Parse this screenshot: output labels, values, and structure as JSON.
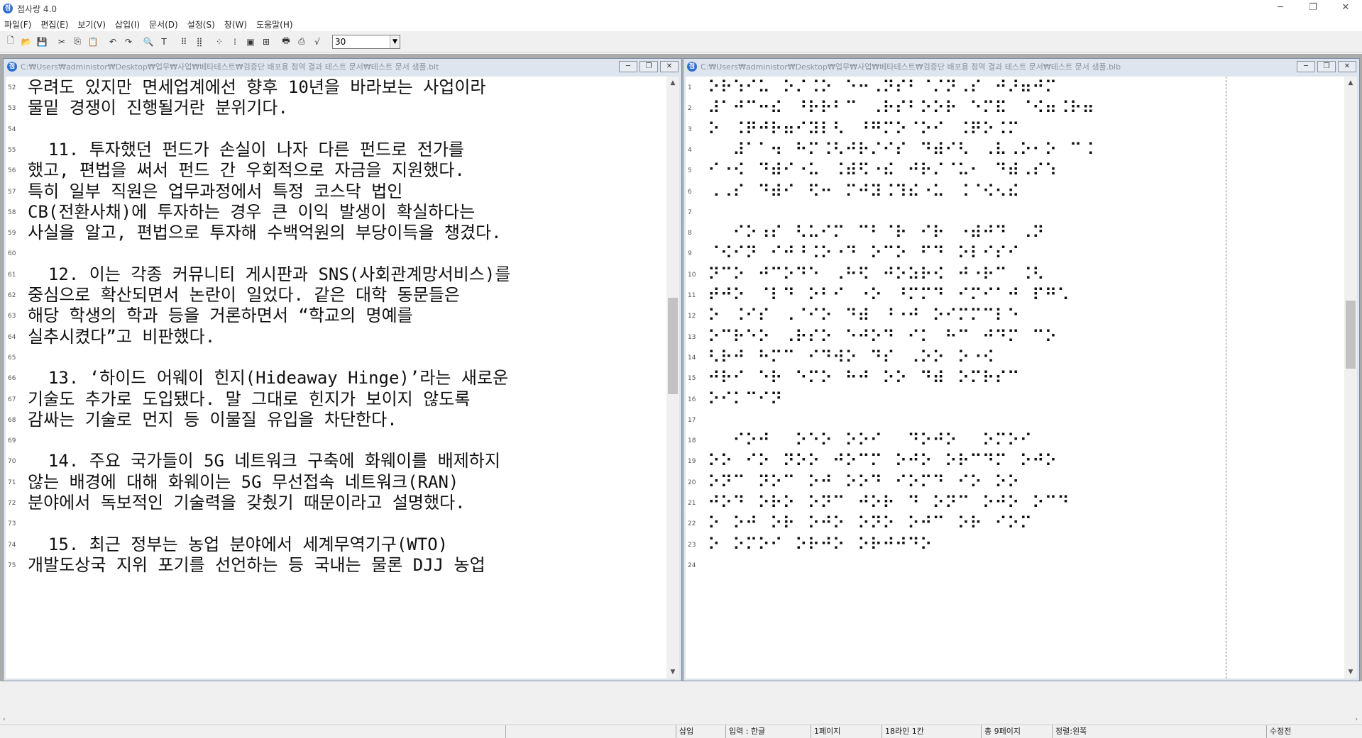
{
  "window": {
    "title": "점사랑 4.0",
    "app_icon": "점",
    "controls": {
      "minimize": "─",
      "restore": "❐",
      "close": "✕"
    }
  },
  "menu": [
    "파일(F)",
    "편집(E)",
    "보기(V)",
    "삽입(I)",
    "문서(D)",
    "설정(S)",
    "창(W)",
    "도움말(H)"
  ],
  "toolbar": {
    "buttons": [
      {
        "icon": "new-file-icon",
        "glyph": "🗋"
      },
      {
        "icon": "open-folder-icon",
        "glyph": "📂"
      },
      {
        "icon": "save-icon",
        "glyph": "💾"
      },
      {
        "icon": "cut-icon",
        "glyph": "✂"
      },
      {
        "icon": "copy-icon",
        "glyph": "⎘"
      },
      {
        "icon": "paste-icon",
        "glyph": "📋"
      },
      {
        "icon": "undo-icon",
        "glyph": "↶"
      },
      {
        "icon": "redo-icon",
        "glyph": "↷"
      },
      {
        "icon": "search-icon",
        "glyph": "🔍"
      },
      {
        "icon": "text-mode-icon",
        "glyph": "T"
      },
      {
        "icon": "braille-cell-icon",
        "glyph": "⠿"
      },
      {
        "icon": "braille-view-icon",
        "glyph": "⣿"
      },
      {
        "icon": "grid-icon",
        "glyph": "⁘"
      },
      {
        "icon": "dots-icon",
        "glyph": "⁞"
      },
      {
        "icon": "box-icon",
        "glyph": "▣"
      },
      {
        "icon": "table-icon",
        "glyph": "⊞"
      },
      {
        "icon": "print-icon",
        "glyph": "🖶"
      },
      {
        "icon": "print-preview-icon",
        "glyph": "⎙"
      },
      {
        "icon": "formula-icon",
        "glyph": "√"
      }
    ],
    "zoom_value": "30",
    "zoom_arrow": "▼"
  },
  "left_doc": {
    "path": "C:₩Users₩administor₩Desktop₩업무₩사업₩베타테스트₩검증단 배포용 점역 결과 테스트 문서₩테스트 문서 샘플.blt",
    "icon": "점",
    "line_numbers": [
      "52",
      "53",
      "54",
      "55",
      "56",
      "57",
      "58",
      "59",
      "60",
      "61",
      "62",
      "63",
      "64",
      "65",
      "66",
      "67",
      "68",
      "69",
      "70",
      "71",
      "72",
      "73",
      "74",
      "75"
    ],
    "lines": [
      "우려도 있지만 면세업계에선 향후 10년을 바라보는 사업이라",
      "물밑 경쟁이 진행될거란 분위기다.",
      "",
      "  11. 투자했던 펀드가 손실이 나자 다른 펀드로 전가를",
      "했고, 편법을 써서 펀드 간 우회적으로 자금을 지원했다.",
      "특히 일부 직원은 업무과정에서 특정 코스닥 법인",
      "CB(전환사채)에 투자하는 경우 큰 이익 발생이 확실하다는",
      "사실을 알고, 편법으로 투자해 수백억원의 부당이득을 챙겼다.",
      "",
      "  12. 이는 각종 커뮤니티 게시판과 SNS(사회관계망서비스)를",
      "중심으로 확산되면서 논란이 일었다. 같은 대학 동문들은",
      "해당 학생의 학과 등을 거론하면서 “학교의 명예를",
      "실추시켰다”고 비판했다.",
      "",
      "  13. ‘하이드 어웨이 힌지(Hideaway Hinge)’라는 새로운",
      "기술도 추가로 도입됐다. 말 그대로 힌지가 보이지 않도록",
      "감싸는 기술로 먼지 등 이물질 유입을 차단한다.",
      "",
      "  14. 주요 국가들이 5G 네트워크 구축에 화웨이를 배제하지",
      "않는 배경에 대해 화웨이는 5G 무선접속 네트워크(RAN)",
      "분야에서 독보적인 기술력을 갖췄기 때문이라고 설명했다.",
      "",
      "  15. 최근 정부는 농업 분야에서 세계무역기구(WTO)",
      "개발도상국 지위 포기를 선언하는 등 국내는 물론 DJJ 농업"
    ]
  },
  "right_doc": {
    "path": "C:₩Users₩administor₩Desktop₩업무₩사업₩베타테스트₩검증단 배포용 점역 결과 테스트 문서₩테스트 문서 샘플.blb",
    "icon": "점",
    "line_numbers": [
      "1",
      "2",
      "3",
      "4",
      "5",
      "6",
      "7",
      "8",
      "9",
      "10",
      "11",
      "12",
      "13",
      "14",
      "15",
      "16",
      "17",
      "18",
      "19",
      "20",
      "21",
      "22",
      "23",
      "24"
    ],
    "lines": [
      "⠕⠗⠱⠊⠥⠀⠕⠌⠨⠕⠀⠑⠒⠠⠝⠎⠃⠈⠌⠝⠠⠎⠀⠚⠜⠶⠚⠍",
      "⠼⠁⠚⠉⠒⠮⠀⠘⠗⠗⠃⠉⠀⠠⠗⠎⠃⠕⠕⠗⠀⠑⠍⠯⠀⠈⠪⠶⠨⠗⠶",
      "⠕⠀⠨⠟⠚⠗⠶⠊⠽⠇⠣⠀⠘⠛⠍⠕⠈⠕⠊⠀⠨⠟⠕⠨⠍",
      "⠀⠀⠼⠁⠁⠲⠀⠓⠍⠨⠣⠚⠗⠌⠊⠎⠀⠙⠾⠊⠣⠀⠠⠧⠠⠕⠂⠕⠀⠉⠨",
      "⠊⠐⠪⠀⠙⠾⠊⠐⠥⠀⠨⠾⠫⠐⠮⠀⠚⠗⠌⠈⠥⠂⠀⠙⠾⠠⠎⠱⠀",
      "⠠⠠⠎⠀⠙⠾⠊⠀⠫⠒⠀⠍⠚⠽⠨⠹⠮⠐⠥⠀⠨⠈⠪⠢⠮",
      "",
      "⠀⠀⠊⠕⠰⠎⠀⠣⠥⠊⠍⠀⠉⠃⠈⠗⠀⠊⠗⠀⠐⠾⠚⠙⠀⠠⠝",
      "⠈⠪⠊⠝⠀⠊⠚⠘⠨⠕⠐⠙⠀⠕⠉⠕⠀⠋⠙⠀⠕⠇⠊⠎⠊",
      "⠝⠉⠕⠀⠚⠉⠕⠙⠑⠀⠠⠓⠫⠀⠚⠕⠵⠗⠪⠀⠚⠐⠗⠉⠀⠨⠣",
      "⠞⠚⠕⠀⠈⠇⠙⠀⠕⠃⠊⠀⠐⠕⠀⠘⠍⠍⠙⠀⠊⠍⠊⠁⠚⠀⠏⠛⠡",
      "⠕⠀⠨⠊⠎⠀⠠⠈⠊⠕⠀⠙⠾⠀⠘⠐⠚⠀⠕⠊⠍⠍⠉⠇⠑",
      "⠕⠉⠗⠑⠕⠀⠠⠗⠎⠕⠀⠑⠚⠕⠙⠀⠊⠅⠀⠓⠉⠀⠚⠙⠍⠀⠉⠕",
      "⠣⠗⠚⠀⠓⠍⠉⠀⠊⠙⠺⠕⠀⠙⠎⠀⠠⠕⠕⠀⠕⠐⠪",
      "⠚⠗⠊⠀⠑⠗⠀⠑⠍⠕⠀⠓⠚⠀⠕⠕⠀⠙⠾⠀⠕⠍⠗⠎⠉",
      "⠕⠊⠅⠉⠊⠝",
      "",
      "⠀⠀⠊⠕⠚⠀⠀⠕⠑⠕⠀⠕⠕⠊⠀⠀⠙⠕⠚⠕⠀⠀⠕⠍⠕⠊",
      "⠕⠕⠀⠊⠕⠀⠝⠕⠕⠀⠚⠕⠉⠍⠀⠕⠚⠕⠀⠕⠗⠉⠙⠍⠀⠕⠚⠕",
      "⠕⠝⠉⠀⠝⠕⠉⠀⠕⠚⠀⠕⠕⠙⠀⠊⠕⠍⠙⠀⠊⠕⠀⠕⠕",
      "⠚⠕⠙⠀⠕⠗⠕⠀⠕⠝⠉⠀⠚⠕⠗⠀⠙⠀⠕⠝⠉⠀⠕⠚⠕⠀⠕⠉⠙",
      "⠕⠀⠕⠚⠀⠕⠗⠀⠕⠚⠕⠀⠕⠝⠕⠀⠕⠚⠉⠀⠕⠗⠀⠊⠕⠍",
      "⠕⠀⠕⠍⠕⠊⠀⠕⠗⠚⠕⠀⠕⠗⠚⠚⠙⠕",
      ""
    ]
  },
  "statusbar": {
    "mode": "삽입",
    "input": "입력 : 한글",
    "page": "1페이지",
    "position": "18라인 1칸",
    "total": "총 9페이지",
    "align": "정렬:왼쪽",
    "modified": "수정전"
  }
}
